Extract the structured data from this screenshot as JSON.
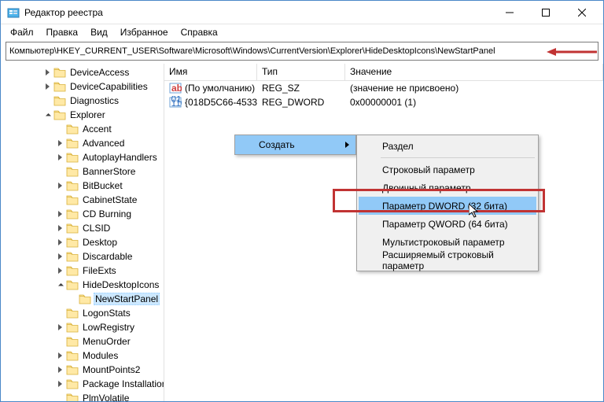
{
  "window": {
    "title": "Редактор реестра",
    "minimize": "—",
    "maximize": "☐",
    "close": "✕"
  },
  "menu": {
    "file": "Файл",
    "edit": "Правка",
    "view": "Вид",
    "favorites": "Избранное",
    "help": "Справка"
  },
  "address": "Компьютер\\HKEY_CURRENT_USER\\Software\\Microsoft\\Windows\\CurrentVersion\\Explorer\\HideDesktopIcons\\NewStartPanel",
  "tree": [
    {
      "indent": 3,
      "twist": "closed",
      "label": "DeviceAccess"
    },
    {
      "indent": 3,
      "twist": "closed",
      "label": "DeviceCapabilities"
    },
    {
      "indent": 3,
      "twist": "none",
      "label": "Diagnostics"
    },
    {
      "indent": 3,
      "twist": "open",
      "label": "Explorer"
    },
    {
      "indent": 4,
      "twist": "none",
      "label": "Accent"
    },
    {
      "indent": 4,
      "twist": "closed",
      "label": "Advanced"
    },
    {
      "indent": 4,
      "twist": "closed",
      "label": "AutoplayHandlers"
    },
    {
      "indent": 4,
      "twist": "none",
      "label": "BannerStore"
    },
    {
      "indent": 4,
      "twist": "closed",
      "label": "BitBucket"
    },
    {
      "indent": 4,
      "twist": "none",
      "label": "CabinetState"
    },
    {
      "indent": 4,
      "twist": "closed",
      "label": "CD Burning"
    },
    {
      "indent": 4,
      "twist": "closed",
      "label": "CLSID"
    },
    {
      "indent": 4,
      "twist": "closed",
      "label": "Desktop"
    },
    {
      "indent": 4,
      "twist": "closed",
      "label": "Discardable"
    },
    {
      "indent": 4,
      "twist": "closed",
      "label": "FileExts"
    },
    {
      "indent": 4,
      "twist": "open",
      "label": "HideDesktopIcons"
    },
    {
      "indent": 5,
      "twist": "none",
      "label": "NewStartPanel",
      "selected": true
    },
    {
      "indent": 4,
      "twist": "none",
      "label": "LogonStats"
    },
    {
      "indent": 4,
      "twist": "closed",
      "label": "LowRegistry"
    },
    {
      "indent": 4,
      "twist": "none",
      "label": "MenuOrder"
    },
    {
      "indent": 4,
      "twist": "closed",
      "label": "Modules"
    },
    {
      "indent": 4,
      "twist": "closed",
      "label": "MountPoints2"
    },
    {
      "indent": 4,
      "twist": "closed",
      "label": "Package Installation"
    },
    {
      "indent": 4,
      "twist": "none",
      "label": "PlmVolatile"
    }
  ],
  "columns": {
    "name": "Имя",
    "type": "Тип",
    "value": "Значение"
  },
  "rows": [
    {
      "icon": "str",
      "name": "(По умолчанию)",
      "type": "REG_SZ",
      "value": "(значение не присвоено)"
    },
    {
      "icon": "bin",
      "name": "{018D5C66-4533...",
      "type": "REG_DWORD",
      "value": "0x00000001 (1)"
    }
  ],
  "context": {
    "parent_label": "Создать",
    "items": [
      {
        "label": "Раздел",
        "sep_after": true
      },
      {
        "label": "Строковый параметр"
      },
      {
        "label": "Двоичный параметр"
      },
      {
        "label": "Параметр DWORD (32 бита)",
        "hover": true
      },
      {
        "label": "Параметр QWORD (64 бита)"
      },
      {
        "label": "Мультистроковый параметр"
      },
      {
        "label": "Расширяемый строковый параметр"
      }
    ]
  }
}
